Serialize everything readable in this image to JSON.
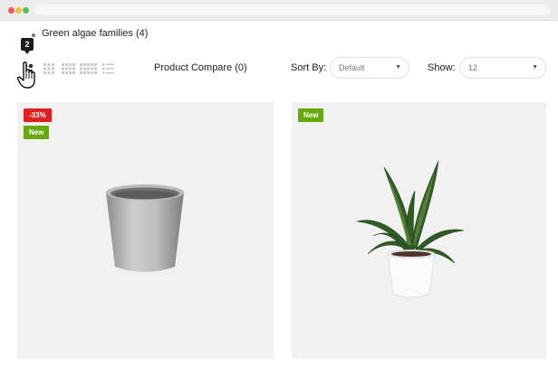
{
  "breadcrumb": {
    "label": "Green algae families (4)"
  },
  "tooltip": {
    "value": "2"
  },
  "toolbar": {
    "compare_label": "Product Compare (0)",
    "sort_label": "Sort By:",
    "sort_value": "Default",
    "show_label": "Show:",
    "show_value": "12"
  },
  "products": [
    {
      "badges": [
        "-33%",
        "New"
      ],
      "image": "concrete-pot"
    },
    {
      "badges": [
        "New"
      ],
      "image": "snake-plant"
    }
  ],
  "colors": {
    "sale": "#e01f1f",
    "new": "#67a90d",
    "card": "#f1f1f1"
  }
}
